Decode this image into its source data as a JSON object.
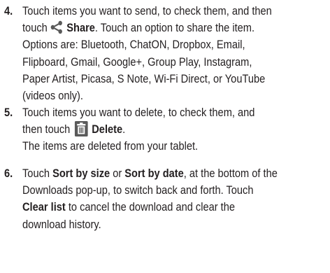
{
  "steps": [
    {
      "number": "4.",
      "line1_a": "Touch items you want to send, to check them, and then",
      "line2_a": "touch",
      "share_icon": "share-icon",
      "line2_bold": "Share",
      "line2_b": ". Touch an option to share the item.",
      "line3": "Options are: Bluetooth, ChatON, Dropbox, Email,",
      "line4": "Flipboard, Gmail, Google+, Group Play, Instagram,",
      "line5": "Paper Artist, Picasa, S Note, Wi-Fi Direct, or YouTube",
      "line6": "(videos only)."
    },
    {
      "number": "5.",
      "line1": "Touch items you want to delete, to check them, and",
      "line2_a": "then touch",
      "delete_icon": "trash-icon",
      "line2_bold": "Delete",
      "line2_b": ".",
      "note": "The items are deleted from your tablet."
    },
    {
      "number": "6.",
      "line1_a": "Touch ",
      "line1_bold1": "Sort by size",
      "line1_b": " or ",
      "line1_bold2": "Sort by date",
      "line1_c": ", at the bottom of the",
      "line2": "Downloads pop-up, to switch back and forth. Touch",
      "line3_bold": "Clear list",
      "line3_b": " to cancel the download and clear the",
      "line4": "download history."
    }
  ],
  "colors": {
    "text": "#231f20",
    "icon_bg": "#5a5a5a",
    "icon_fg": "#ffffff"
  }
}
